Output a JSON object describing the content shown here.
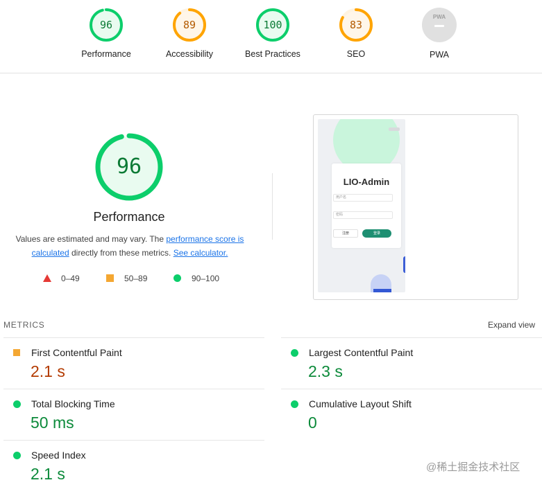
{
  "colors": {
    "pass": "#0cce6b",
    "average": "#ffa400",
    "fail": "#ff4e42",
    "pwa_gray": "#e0e0e0"
  },
  "categories": [
    {
      "score": 96,
      "label": "Performance",
      "status": "pass"
    },
    {
      "score": 89,
      "label": "Accessibility",
      "status": "average"
    },
    {
      "score": 100,
      "label": "Best Practices",
      "status": "pass"
    },
    {
      "score": 83,
      "label": "SEO",
      "status": "average"
    },
    {
      "label": "PWA",
      "badge": "PWA",
      "status": "na"
    }
  ],
  "performance": {
    "score": 96,
    "title": "Performance",
    "desc_prefix": "Values are estimated and may vary. The ",
    "score_link": "performance score is calculated",
    "desc_middle": " directly from these metrics. ",
    "calc_link": "See calculator.",
    "legend": [
      {
        "icon": "triangle-icon",
        "range": "0–49"
      },
      {
        "icon": "square-icon",
        "range": "50–89"
      },
      {
        "icon": "circle-icon",
        "range": "90–100"
      }
    ]
  },
  "screenshot": {
    "app_title": "LIO-Admin",
    "username_placeholder": "用户名",
    "password_placeholder": "密码",
    "left_button": "注册",
    "right_button": "登录"
  },
  "metrics": {
    "header": "METRICS",
    "expand": "Expand view",
    "items": [
      {
        "name": "First Contentful Paint",
        "value": "2.1 s",
        "status": "average"
      },
      {
        "name": "Largest Contentful Paint",
        "value": "2.3 s",
        "status": "pass"
      },
      {
        "name": "Total Blocking Time",
        "value": "50 ms",
        "status": "pass"
      },
      {
        "name": "Cumulative Layout Shift",
        "value": "0",
        "status": "pass"
      },
      {
        "name": "Speed Index",
        "value": "2.1 s",
        "status": "pass"
      }
    ]
  },
  "watermark": "@稀土掘金技术社区"
}
